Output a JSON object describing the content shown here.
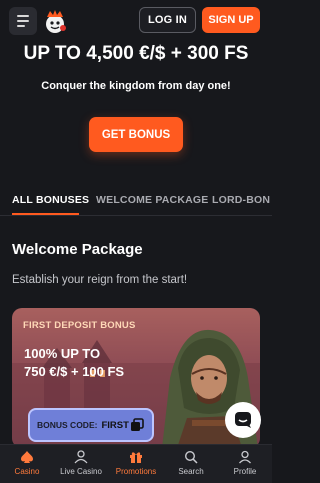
{
  "header": {
    "login_label": "LOG IN",
    "signup_label": "SIGN UP"
  },
  "hero": {
    "title": "UP TO 4,500 €/$ + 300 FS",
    "subtitle": "Conquer the kingdom from day one!",
    "cta_label": "GET BONUS"
  },
  "tabs": [
    {
      "label": "ALL BONUSES",
      "active": true
    },
    {
      "label": "WELCOME PACKAGE",
      "active": false
    },
    {
      "label": "LORD-BON",
      "active": false
    }
  ],
  "section": {
    "title": "Welcome Package",
    "subtitle": "Establish your reign from the start!"
  },
  "card": {
    "label": "FIRST DEPOSIT BONUS",
    "offer_line1": "100% UP TO",
    "offer_line2": "750 €/$ + 100 FS",
    "code_label": "BONUS CODE:",
    "code_value": "FIRST"
  },
  "bottom_nav": [
    {
      "label": "Casino",
      "icon": "spade-icon",
      "active": true
    },
    {
      "label": "Live Casino",
      "icon": "dealer-icon",
      "active": false
    },
    {
      "label": "Promotions",
      "icon": "gift-icon",
      "active": false
    },
    {
      "label": "Search",
      "icon": "search-icon",
      "active": false
    },
    {
      "label": "Profile",
      "icon": "user-icon",
      "active": false
    }
  ],
  "colors": {
    "accent": "#ff5a1f",
    "background": "#17181c",
    "code_box": "#6f7fd8"
  }
}
